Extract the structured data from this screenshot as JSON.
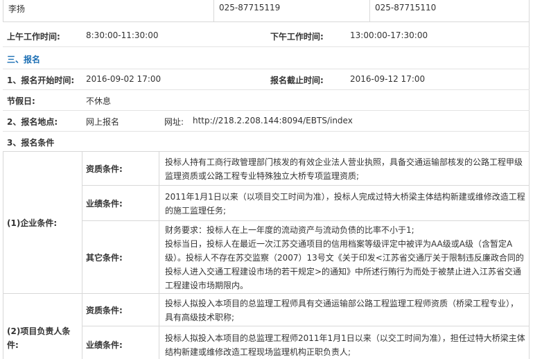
{
  "contact_row": {
    "name": "李扬",
    "phone_1": "025-87715119",
    "phone_2": "025-87715110"
  },
  "work_hours": {
    "morning_label": "上午工作时间:",
    "morning_value": "8:30:00-11:30:00",
    "afternoon_label": "下午工作时间:",
    "afternoon_value": "13:00:00-17:30:00"
  },
  "section_three": "三、报名",
  "registration": {
    "start_label": "1、报名开始时间:",
    "start_value": "2016-09-02 17:00",
    "end_label": "报名截止时间:",
    "end_value": "2016-09-12 17:00",
    "holiday_label": "节假日:",
    "holiday_value": "不休息",
    "place_label": "2、报名地点:",
    "place_value": "网上报名",
    "url_label": "网址:",
    "url_value": "http://218.2.208.144:8094/EBTS/index",
    "conditions_label": "3、报名条件"
  },
  "enterprise": {
    "label": "(1)企业条件:",
    "qualification_label": "资质条件:",
    "qualification_text": "投标人持有工商行政管理部门核发的有效企业法人营业执照，具备交通运输部核发的公路工程甲级监理资质或公路工程专业特殊独立大桥专项监理资质;",
    "performance_label": "业绩条件:",
    "performance_text": "2011年1月1日以来（以项目交工时间为准），投标人完成过特大桥梁主体结构新建或维修改造工程的施工监理任务;",
    "other_label": "其它条件:",
    "other_text_1": "财务要求：投标人在上一年度的流动资产与流动负债的比率不小于1;",
    "other_text_2": "投标当日，投标人在最近一次江苏交通项目的信用档案等级评定中被评为AA级或A级（含暂定A级）。投标人不存在苏交监察（2007）13号文《关于印发<江苏省交通厅关于限制违反廉政合同的投标人进入交通工程建设市场的若干规定>的通知》中所述行贿行为而处于被禁止进入江苏省交通工程建设市场期限内。"
  },
  "project_lead": {
    "label": "(2)项目负责人条件:",
    "qualification_label": "资质条件:",
    "qualification_text": "投标人拟投入本项目的总监理工程师具有交通运输部公路工程监理工程师资质（桥梁工程专业），具有高级技术职称;",
    "performance_label": "业绩条件:",
    "performance_text": "投标人拟投入本项目的总监理工程师2011年1月1日以来（以交工时间为准），担任过特大桥梁主体结构新建或维修改造工程现场监理机构正职负责人;"
  }
}
